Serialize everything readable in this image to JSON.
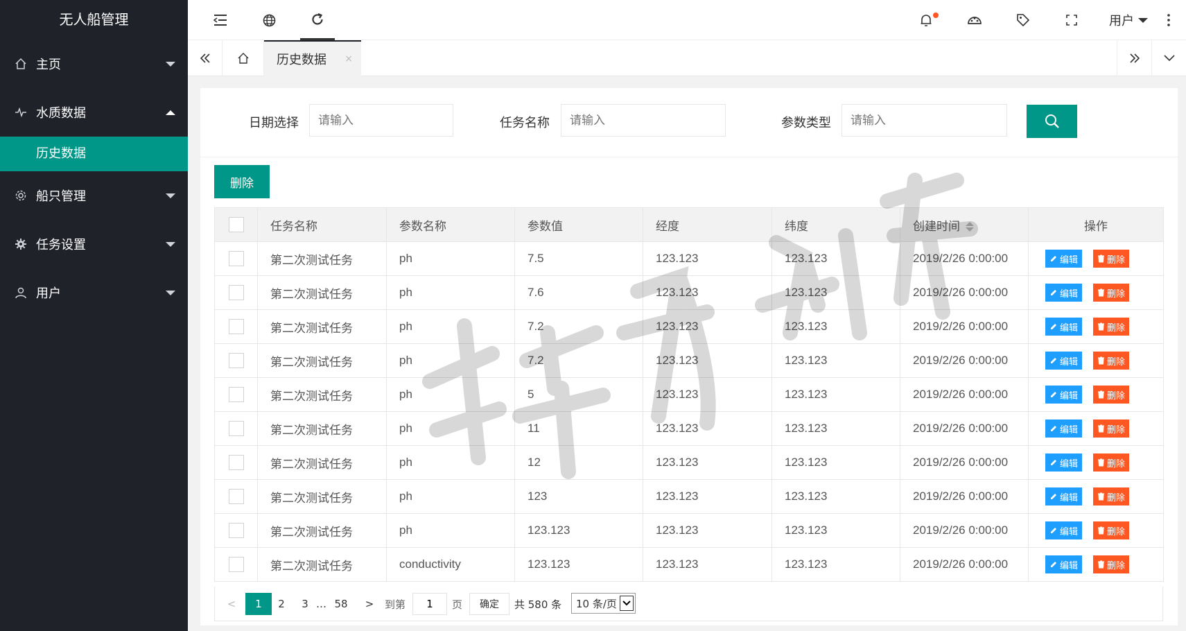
{
  "app": {
    "title": "无人船管理"
  },
  "sidebar": {
    "items": [
      {
        "label": "主页",
        "icon": "home-icon",
        "expanded": false
      },
      {
        "label": "水质数据",
        "icon": "pulse-icon",
        "expanded": true,
        "sub": [
          {
            "label": "历史数据",
            "active": true
          }
        ]
      },
      {
        "label": "船只管理",
        "icon": "settings-icon",
        "expanded": false
      },
      {
        "label": "任务设置",
        "icon": "gear-icon",
        "expanded": false
      },
      {
        "label": "用户",
        "icon": "user-icon",
        "expanded": false
      }
    ]
  },
  "header": {
    "user_label": "用户",
    "icons": [
      "menu-collapse-icon",
      "globe-icon",
      "refresh-icon",
      "bell-icon",
      "theme-icon",
      "tag-icon",
      "fullscreen-icon",
      "more-icon"
    ],
    "notification_dot_color": "#ff5722"
  },
  "tabs": {
    "active_label": "历史数据",
    "close": "×"
  },
  "search": {
    "fields": [
      {
        "label": "日期选择",
        "placeholder": "请输入"
      },
      {
        "label": "任务名称",
        "placeholder": "请输入"
      },
      {
        "label": "参数类型",
        "placeholder": "请输入"
      }
    ]
  },
  "toolbar": {
    "delete_label": "删除"
  },
  "table": {
    "headers": [
      "任务名称",
      "参数名称",
      "参数值",
      "经度",
      "纬度",
      "创建时间",
      "操作"
    ],
    "edit_label": "编辑",
    "delete_label": "删除",
    "rows": [
      [
        "第二次测试任务",
        "ph",
        "7.5",
        "123.123",
        "123.123",
        "2019/2/26 0:00:00"
      ],
      [
        "第二次测试任务",
        "ph",
        "7.6",
        "123.123",
        "123.123",
        "2019/2/26 0:00:00"
      ],
      [
        "第二次测试任务",
        "ph",
        "7.2",
        "123.123",
        "123.123",
        "2019/2/26 0:00:00"
      ],
      [
        "第二次测试任务",
        "ph",
        "7.2",
        "123.123",
        "123.123",
        "2019/2/26 0:00:00"
      ],
      [
        "第二次测试任务",
        "ph",
        "5",
        "123.123",
        "123.123",
        "2019/2/26 0:00:00"
      ],
      [
        "第二次测试任务",
        "ph",
        "11",
        "123.123",
        "123.123",
        "2019/2/26 0:00:00"
      ],
      [
        "第二次测试任务",
        "ph",
        "12",
        "123.123",
        "123.123",
        "2019/2/26 0:00:00"
      ],
      [
        "第二次测试任务",
        "ph",
        "123",
        "123.123",
        "123.123",
        "2019/2/26 0:00:00"
      ],
      [
        "第二次测试任务",
        "ph",
        "123.123",
        "123.123",
        "123.123",
        "2019/2/26 0:00:00"
      ],
      [
        "第二次测试任务",
        "conductivity",
        "123.123",
        "123.123",
        "123.123",
        "2019/2/26 0:00:00"
      ]
    ]
  },
  "pager": {
    "prev": "<",
    "pages": [
      "1",
      "2",
      "3"
    ],
    "ellipsis": "…",
    "last": "58",
    "next": ">",
    "goto_label": "到第",
    "goto_value": "1",
    "page_unit": "页",
    "confirm": "确定",
    "total": "共 580 条",
    "per_page": "10 条/页"
  },
  "colors": {
    "primary": "#009688",
    "sidebar": "#20222a",
    "edit": "#1e9fff",
    "danger": "#ff5722"
  }
}
